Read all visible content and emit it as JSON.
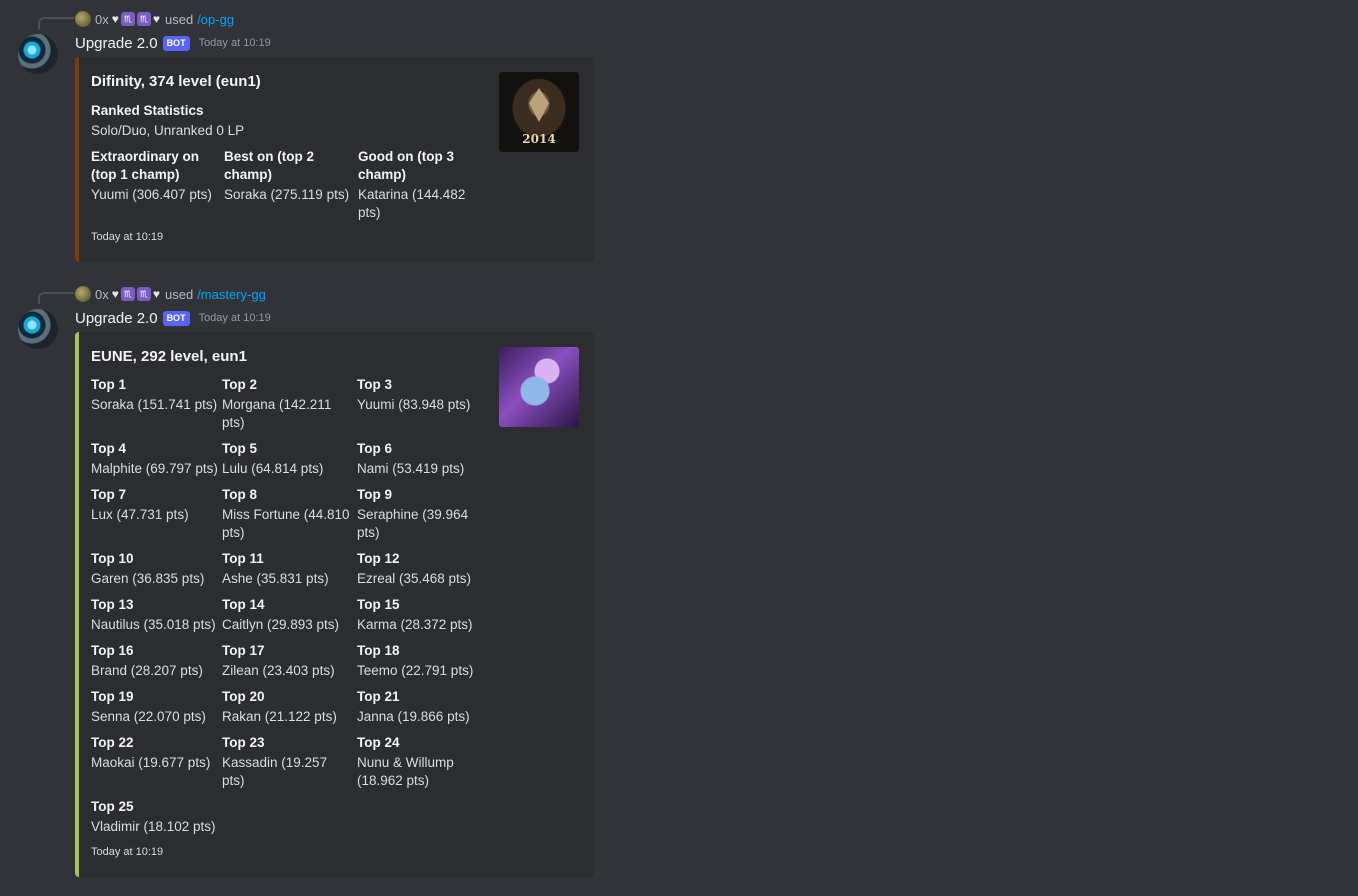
{
  "colors": {
    "background": "#313338",
    "embed_bg": "#2b2d31",
    "embed1_border": "#7a3f0a",
    "embed2_border": "#a4c35a",
    "link": "#00a8fc",
    "bot_badge": "#5865f2"
  },
  "messages": [
    {
      "reply": {
        "user": "0x",
        "used": "used",
        "command": "/op-gg"
      },
      "author": "Upgrade 2.0",
      "bot_badge": "BOT",
      "timestamp": "Today at 10:19",
      "embed": {
        "title": "Difinity, 374 level (eun1)",
        "section_title": "Ranked Statistics",
        "section_value": "Solo/Duo, Unranked 0 LP",
        "fields": [
          {
            "name": "Extraordinary on (top 1 champ)",
            "value": "Yuumi (306.407 pts)"
          },
          {
            "name": "Best on (top 2 champ)",
            "value": "Soraka (275.119 pts)"
          },
          {
            "name": "Good on (top 3 champ)",
            "value": "Katarina (144.482 pts)"
          }
        ],
        "thumbnail_text": "2014",
        "footer": "Today at 10:19"
      }
    },
    {
      "reply": {
        "user": "0x",
        "used": "used",
        "command": "/mastery-gg"
      },
      "author": "Upgrade 2.0",
      "bot_badge": "BOT",
      "timestamp": "Today at 10:19",
      "embed": {
        "title": "EUNE, 292 level, eun1",
        "fields": [
          {
            "name": "Top 1",
            "value": "Soraka (151.741 pts)"
          },
          {
            "name": "Top 2",
            "value": "Morgana (142.211 pts)"
          },
          {
            "name": "Top 3",
            "value": "Yuumi (83.948 pts)"
          },
          {
            "name": "Top 4",
            "value": "Malphite (69.797 pts)"
          },
          {
            "name": "Top 5",
            "value": "Lulu (64.814 pts)"
          },
          {
            "name": "Top 6",
            "value": "Nami (53.419 pts)"
          },
          {
            "name": "Top 7",
            "value": "Lux (47.731 pts)"
          },
          {
            "name": "Top 8",
            "value": "Miss Fortune (44.810 pts)"
          },
          {
            "name": "Top 9",
            "value": "Seraphine (39.964 pts)"
          },
          {
            "name": "Top 10",
            "value": "Garen (36.835 pts)"
          },
          {
            "name": "Top 11",
            "value": "Ashe (35.831 pts)"
          },
          {
            "name": "Top 12",
            "value": "Ezreal (35.468 pts)"
          },
          {
            "name": "Top 13",
            "value": "Nautilus (35.018 pts)"
          },
          {
            "name": "Top 14",
            "value": "Caitlyn (29.893 pts)"
          },
          {
            "name": "Top 15",
            "value": "Karma (28.372 pts)"
          },
          {
            "name": "Top 16",
            "value": "Brand (28.207 pts)"
          },
          {
            "name": "Top 17",
            "value": "Zilean (23.403 pts)"
          },
          {
            "name": "Top 18",
            "value": "Teemo (22.791 pts)"
          },
          {
            "name": "Top 19",
            "value": "Senna (22.070 pts)"
          },
          {
            "name": "Top 20",
            "value": "Rakan (21.122 pts)"
          },
          {
            "name": "Top 21",
            "value": "Janna (19.866 pts)"
          },
          {
            "name": "Top 22",
            "value": "Maokai (19.677 pts)"
          },
          {
            "name": "Top 23",
            "value": "Kassadin (19.257 pts)"
          },
          {
            "name": "Top 24",
            "value": "Nunu & Willump (18.962 pts)"
          },
          {
            "name": "Top 25",
            "value": "Vladimir (18.102 pts)"
          }
        ],
        "footer": "Today at 10:19"
      }
    }
  ]
}
